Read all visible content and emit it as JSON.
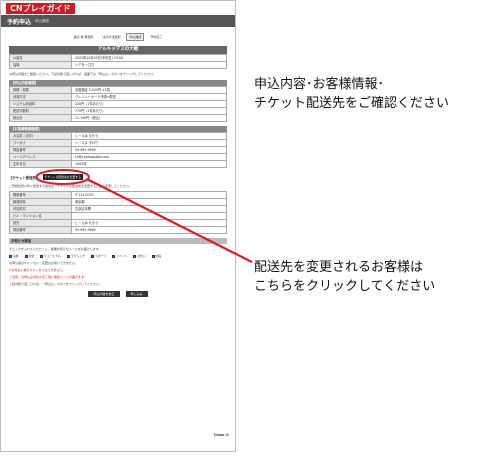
{
  "app": {
    "logo": "CNプレイガイド"
  },
  "header": {
    "title": "予約申込",
    "subtitle": "申込確認"
  },
  "steps": [
    "講演 後 再選択",
    "決済方法選択",
    "申込確認",
    "予約完了"
  ],
  "event": {
    "title": "アルキメデスの大戦"
  },
  "info_rows": [
    {
      "label": "公演日",
      "value": "2022年10月30日(予約日) 13:00"
    },
    {
      "label": "会場",
      "value": "シアター〇〇"
    }
  ],
  "intro_note": "お申込内容をご確認ください。下記内容で宜しければ、画面下の「申込む」ボタンをクリックしてください。",
  "order_section": {
    "title": "【申込内容確認】",
    "rows": [
      {
        "label": "券種・枚数",
        "value": "全席指定 5,200円 ×1枚"
      },
      {
        "label": "決済方法",
        "value": "クレジットカード決済+配送"
      },
      {
        "label": "システム利用料",
        "value": "220円（1件あたり）"
      },
      {
        "label": "配送手数料",
        "value": "770円（1件あたり）"
      },
      {
        "label": "総合計",
        "value": "11,190円（税込）"
      }
    ]
  },
  "customer_section": {
    "title": "【お客様情報確認】",
    "rows": [
      {
        "label": "お名前（漢字）",
        "value": "しーえぬ たろう"
      },
      {
        "label": "フリガナ",
        "value": "シーエヌ タロウ"
      },
      {
        "label": "電話番号",
        "value": "03-992-9956"
      },
      {
        "label": "メールアドレス",
        "value": "cn@cnplayguide.com"
      },
      {
        "label": "生年月日",
        "value": "19XX年"
      }
    ]
  },
  "ticket_section": {
    "title": "【チケット配送先】",
    "change_button": "チケットの配送先を変更する",
    "note": "ご登録住所以外に配送する場合は「チケットの配送先を変更する」より変更してください。",
    "rows": [
      {
        "label": "郵便番号",
        "value": "〒113-0033"
      },
      {
        "label": "都道府県",
        "value": "東京都"
      },
      {
        "label": "市区町村",
        "value": "文京区本郷"
      },
      {
        "label": "ビル・マンション名",
        "value": ""
      },
      {
        "label": "宛先",
        "value": "しーえぬ たろう"
      },
      {
        "label": "電話番号",
        "value": "03-992-9956"
      }
    ]
  },
  "mail_section": {
    "title": "お知らせ配信",
    "note": "チェックを入れていただくと、各種お知らせメールをお届けします。",
    "options": [
      "演劇",
      "音楽",
      "ミュージカル",
      "クラシック",
      "スポーツ",
      "イベント",
      "お笑い",
      "映画"
    ]
  },
  "warnings": [
    "お申込後のキャンセル・変更はお受けできません。",
    "※お支払い後のキャンセルはできません。",
    "ご注意：お申込み手続き完了後に確認メールが届きます。"
  ],
  "confirm_note": "上記内容で宜しければ、「申込む」ボタンをクリックしてください。",
  "buttons": {
    "back": "申込内容を修正",
    "submit": "申し込み"
  },
  "close_label": "Close ☒",
  "callouts": {
    "top": [
      "申込内容･お客様情報･",
      "チケット配送先をご確認ください"
    ],
    "bottom": [
      "配送先を変更されるお客様は",
      "こちらをクリックしてください"
    ]
  },
  "colors": {
    "brand": "#d7171f",
    "annotation": "#e8171f"
  }
}
